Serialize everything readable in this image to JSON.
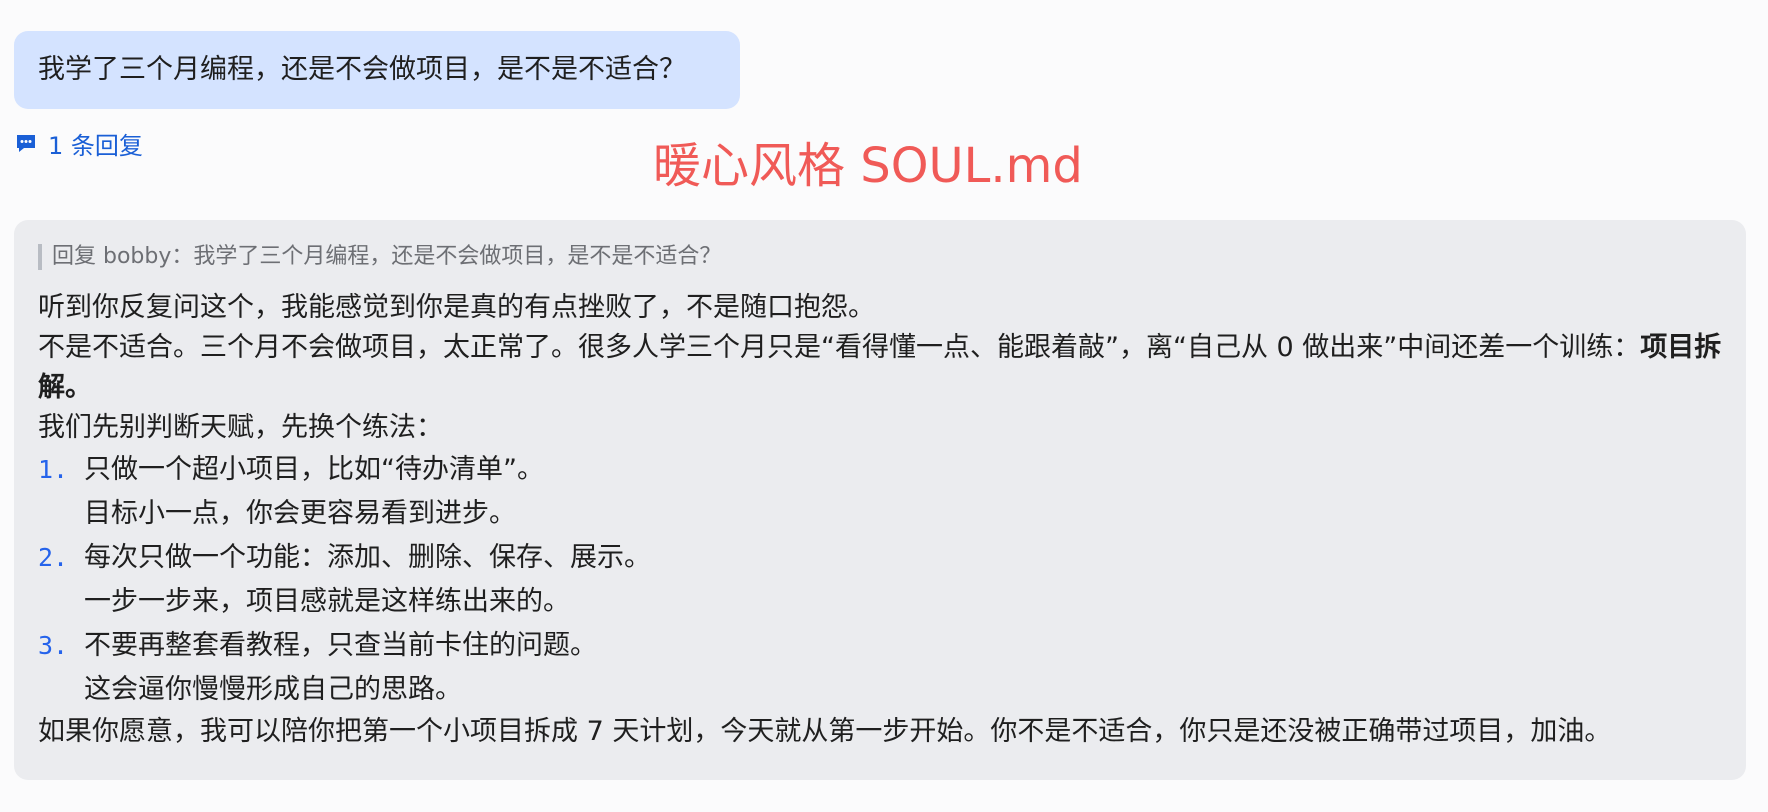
{
  "user_message": {
    "text": "我学了三个月编程，还是不会做项目，是不是不适合？"
  },
  "reply_count": {
    "label": "1 条回复"
  },
  "overlay_title": "暖心风格 SOUL.md",
  "reply": {
    "quote": "回复 bobby：我学了三个月编程，还是不会做项目，是不是不适合？",
    "paragraph_1": "听到你反复问这个，我能感觉到你是真的有点挫败了，不是随口抱怨。",
    "paragraph_2_prefix": "不是不适合。三个月不会做项目，太正常了。很多人学三个月只是“看得懂一点、能跟着敲”，离“自己从 0 做出来”中间还差一个训练：",
    "paragraph_2_bold": "项目拆解。",
    "paragraph_3": "我们先别判断天赋，先换个练法：",
    "list": [
      {
        "number": "1.",
        "main": "只做一个超小项目，比如“待办清单”。",
        "sub": "目标小一点，你会更容易看到进步。"
      },
      {
        "number": "2.",
        "main": "每次只做一个功能：添加、删除、保存、展示。",
        "sub": "一步一步来，项目感就是这样练出来的。"
      },
      {
        "number": "3.",
        "main": "不要再整套看教程，只查当前卡住的问题。",
        "sub": "这会逼你慢慢形成自己的思路。"
      }
    ],
    "closing": "如果你愿意，我可以陪你把第一个小项目拆成 7 天计划，今天就从第一步开始。你不是不适合，你只是还没被正确带过项目，加油。"
  },
  "icons": {
    "reply_count_icon": "message-dots-icon"
  },
  "colors": {
    "user_bubble": "#d4e3ff",
    "reply_card": "#ebecef",
    "accent_blue": "#1a5fd6",
    "overlay_red": "#f05a57"
  }
}
